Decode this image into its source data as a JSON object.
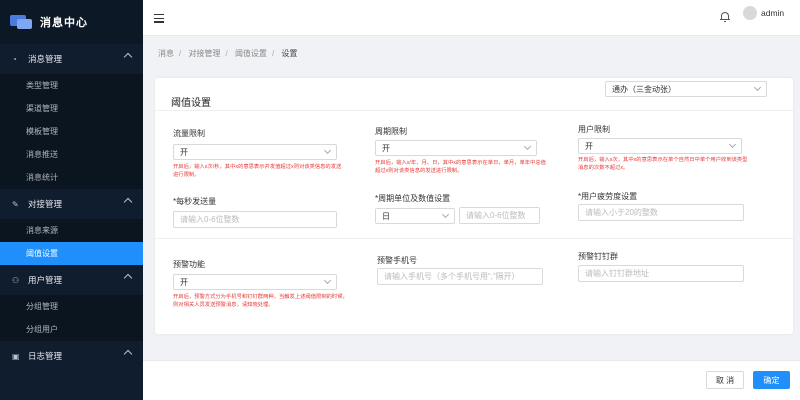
{
  "app": {
    "title": "消息中心"
  },
  "sidebar": {
    "groups": [
      {
        "label": "消息管理",
        "icon": "gauge-icon",
        "items": [
          "类型管理",
          "渠道管理",
          "模板管理",
          "消息推送",
          "消息统计"
        ]
      },
      {
        "label": "对接管理",
        "icon": "edit-icon",
        "items": [
          "消息来源",
          "阈值设置"
        ]
      },
      {
        "label": "用户管理",
        "icon": "users-icon",
        "items": [
          "分组管理",
          "分组用户"
        ]
      },
      {
        "label": "日志管理",
        "icon": "log-icon",
        "items": []
      }
    ],
    "active_item": "阈值设置"
  },
  "header": {
    "user": "admin"
  },
  "breadcrumb": [
    "消息",
    "对接管理",
    "阈值设置",
    "设置"
  ],
  "card": {
    "title": "阈值设置",
    "source_select": "通办（三金动张）",
    "flow_limit": {
      "label": "流量限制",
      "value": "开",
      "hint": "开启后，输入x次/秒，其中x的意思表示并发值超过x则对该类信息的发送进行限制。"
    },
    "period_limit": {
      "label": "周期限制",
      "value": "开",
      "hint": "开启后，输入x/年、月、日，其中x的意思表示在单日，单月，单年中总值超过x则对该类信息的发送进行限制。"
    },
    "user_limit": {
      "label": "用户限制",
      "value": "开",
      "hint": "开启后，输入x次，其中x的意思表示在单个自然日中单个用户收到该类型消息的次数不超过x。"
    },
    "per_second": {
      "label": "*每秒发送量",
      "placeholder": "请输入0-6位整数"
    },
    "period_unit": {
      "label": "*周期单位及数值设置",
      "unit": "日",
      "placeholder": "请输入0-6位整数"
    },
    "fatigue": {
      "label": "*用户疲劳度设置",
      "placeholder": "请输入小于20的整数"
    },
    "warning": {
      "label": "预警功能",
      "value": "开",
      "hint": "开启后，预警方式分为手机号和钉钉群两种，当触发上述阈值限制的时候，则对相关人员发送预警消息，请知晓处理。"
    },
    "warning_phone": {
      "label": "预警手机号",
      "placeholder": "请输入手机号（多个手机号用“,”隔开）"
    },
    "warning_dingtalk": {
      "label": "预警钉钉群",
      "placeholder": "请输入钉钉群地址"
    }
  },
  "footer": {
    "cancel": "取 消",
    "ok": "确定"
  },
  "colors": {
    "sidebar_bg": "#0f1d2e",
    "accent": "#1f8ffc",
    "hint": "#e53935"
  }
}
